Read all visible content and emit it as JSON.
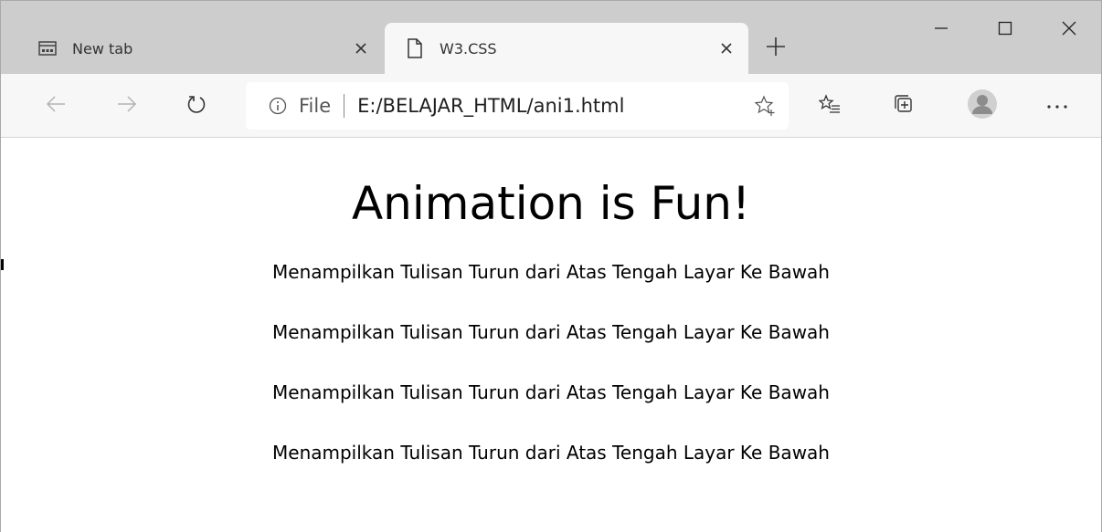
{
  "tabs": [
    {
      "title": "New tab",
      "icon": "new-tab-page-icon"
    },
    {
      "title": "W3.CSS",
      "icon": "document-icon"
    }
  ],
  "address_bar": {
    "scheme": "File",
    "url": "E:/BELAJAR_HTML/ani1.html"
  },
  "page": {
    "heading": "Animation is Fun!",
    "lines": [
      "Menampilkan Tulisan Turun dari Atas Tengah Layar Ke Bawah",
      "Menampilkan Tulisan Turun dari Atas Tengah Layar Ke Bawah",
      "Menampilkan Tulisan Turun dari Atas Tengah Layar Ke Bawah",
      "Menampilkan Tulisan Turun dari Atas Tengah Layar Ke Bawah"
    ]
  },
  "colors": {
    "tabstrip": "#cdcdcd",
    "toolbar": "#f7f7f7",
    "icon": "#444444"
  }
}
